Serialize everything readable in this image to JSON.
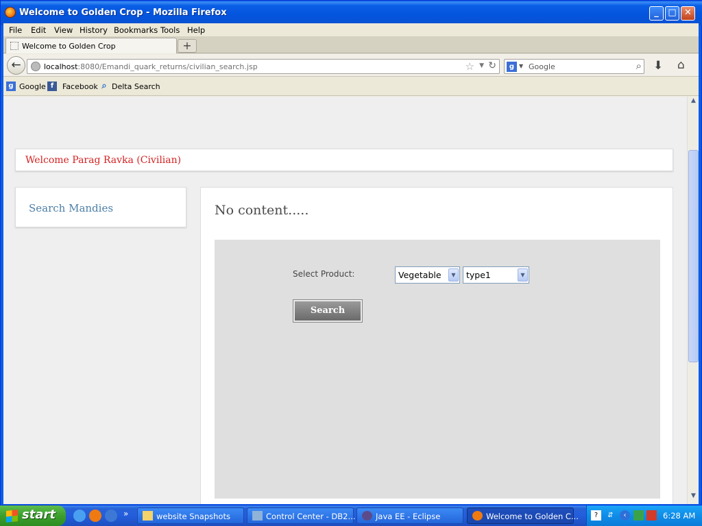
{
  "window": {
    "title": "Welcome to Golden Crop - Mozilla Firefox"
  },
  "menu": [
    "File",
    "Edit",
    "View",
    "History",
    "Bookmarks",
    "Tools",
    "Help"
  ],
  "tab": {
    "label": "Welcome to Golden Crop"
  },
  "nav": {
    "url_host": "localhost",
    "url_rest": ":8080/Emandi_quark_returns/civilian_search.jsp",
    "search_placeholder": "Google"
  },
  "bookmarks": [
    "Google",
    "Facebook",
    "Delta Search"
  ],
  "page": {
    "welcome": "Welcome Parag Ravka (Civilian)",
    "sidebar_link": "Search Mandies",
    "main_title": "No content.....",
    "form": {
      "label": "Select Product:",
      "category_value": "Vegetable",
      "type_value": "type1",
      "search_label": "Search"
    }
  },
  "taskbar": {
    "start_label": "start",
    "tasks": [
      "website Snapshots",
      "Control Center - DB2...",
      "Java EE - Eclipse",
      "Welcome to Golden C..."
    ],
    "clock": "6:28 AM"
  },
  "colors": {
    "welcome_text": "#d42222",
    "sidebar_link": "#4c7ea6",
    "form_bg": "#dfdfdf",
    "button": "#7a7a7a"
  }
}
